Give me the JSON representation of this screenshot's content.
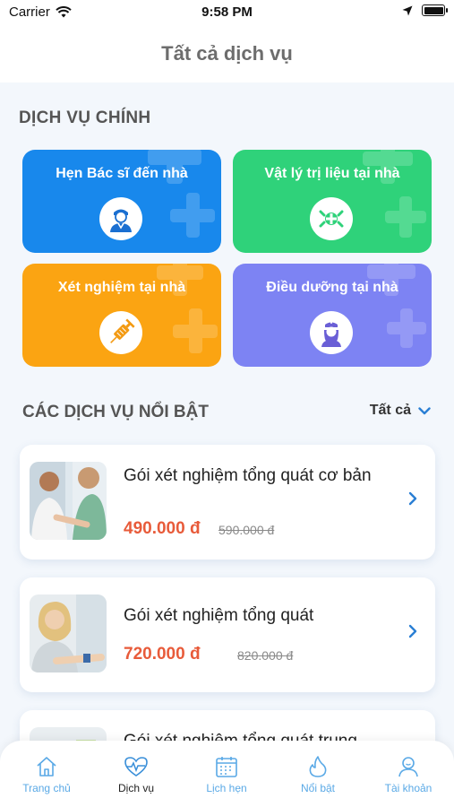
{
  "status_bar": {
    "carrier": "Carrier",
    "time": "9:58 PM"
  },
  "header": {
    "title": "Tất cả dịch vụ"
  },
  "main_services": {
    "title": "DỊCH VỤ CHÍNH",
    "items": [
      {
        "label": "Hẹn Bác sĩ đến nhà",
        "color": "#1888ec",
        "icon": "doctor-icon"
      },
      {
        "label": "Vật lý trị liệu tại nhà",
        "color": "#2fd27a",
        "icon": "physio-icon"
      },
      {
        "label": "Xét nghiệm tại nhà",
        "color": "#fba412",
        "icon": "syringe-icon"
      },
      {
        "label": "Điều dưỡng tại nhà",
        "color": "#7d83f3",
        "icon": "nurse-icon"
      }
    ]
  },
  "featured": {
    "title": "CÁC DỊCH VỤ NỔI BẬT",
    "filter_label": "Tất cả",
    "items": [
      {
        "name": "Gói xét nghiệm tổng quát cơ bản",
        "price": "490.000 đ",
        "old_price": "590.000 đ"
      },
      {
        "name": "Gói xét nghiệm tổng quát",
        "price": "720.000 đ",
        "old_price": "820.000 đ"
      },
      {
        "name": "Gói xét nghiệm tổng quát trung"
      }
    ]
  },
  "tabbar": {
    "items": [
      {
        "label": "Trang chủ",
        "icon": "home-icon"
      },
      {
        "label": "Dịch vụ",
        "icon": "heartbeat-icon",
        "active": true
      },
      {
        "label": "Lịch hẹn",
        "icon": "calendar-icon"
      },
      {
        "label": "Nổi bật",
        "icon": "flame-icon"
      },
      {
        "label": "Tài khoản",
        "icon": "user-icon"
      }
    ]
  }
}
